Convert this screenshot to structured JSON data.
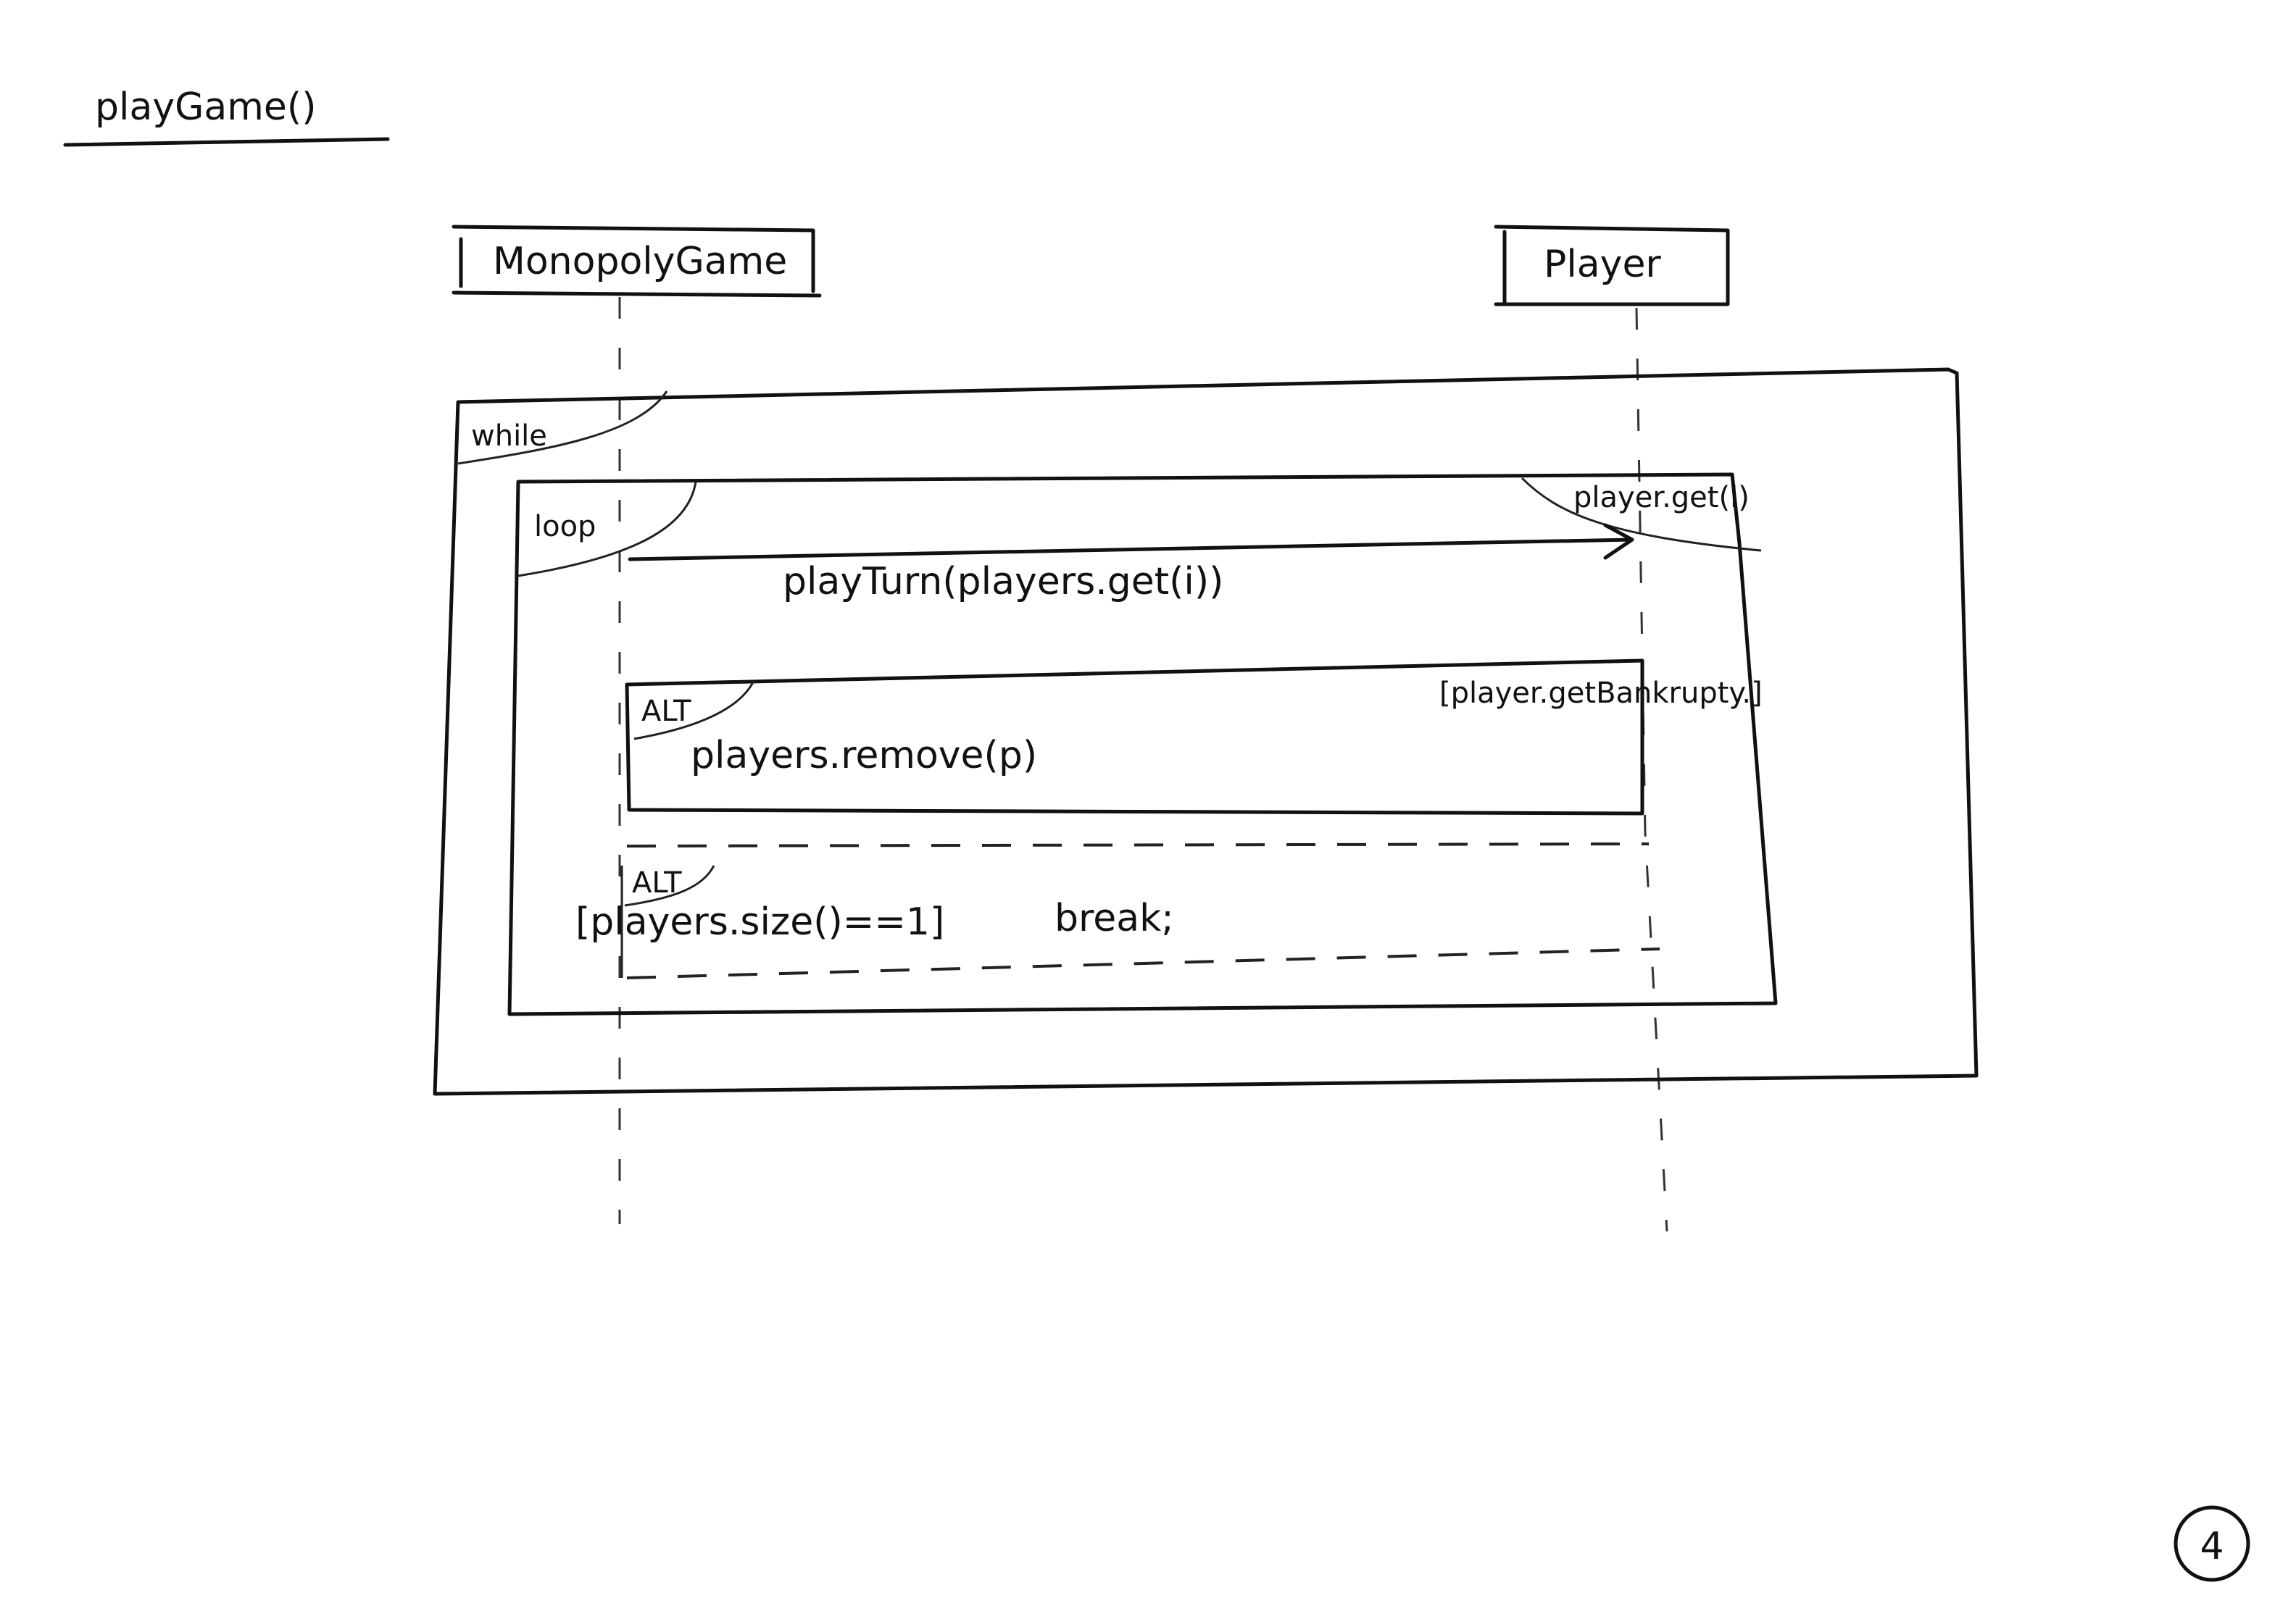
{
  "title": "playGame()",
  "participants": [
    {
      "name": "MonopolyGame"
    },
    {
      "name": "Player"
    }
  ],
  "frames": {
    "while_label": "while",
    "loop_label": "loop",
    "loop_guard": "player.get(i)",
    "alt1_label": "ALT",
    "alt1_guard": "[player.getBankrupty.]",
    "alt1_action": "players.remove(p)",
    "alt2_label": "ALT",
    "alt2_guard": "[players.size()==1]",
    "alt2_action": "break;"
  },
  "messages": [
    {
      "label": "playTurn(players.get(i))",
      "from": "MonopolyGame",
      "to": "Player"
    }
  ],
  "page_number": "4"
}
